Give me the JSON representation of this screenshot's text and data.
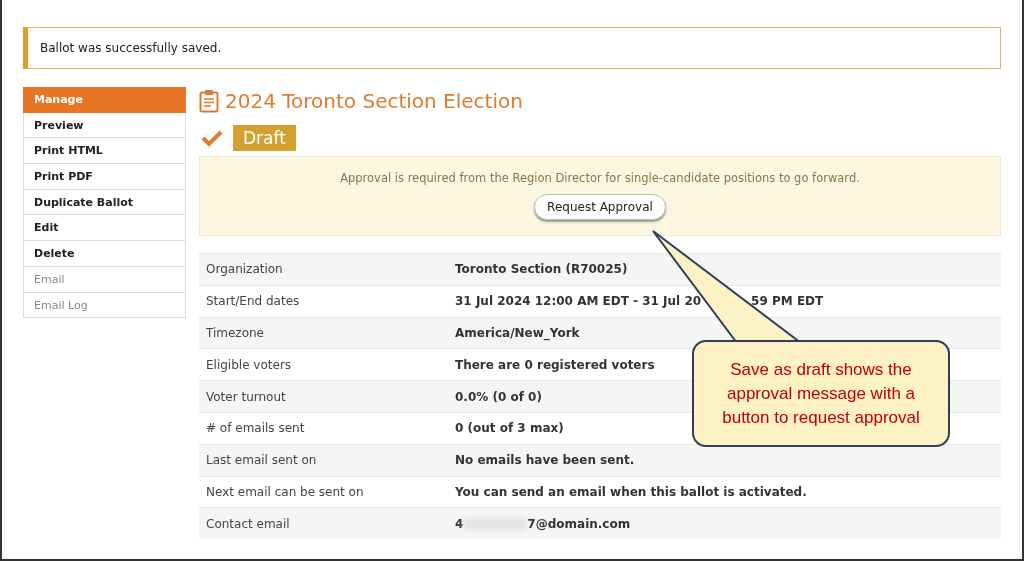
{
  "notice": {
    "text": "Ballot was successfully saved."
  },
  "sidebar": {
    "items": [
      {
        "label": "Manage",
        "selected": true,
        "disabled": false
      },
      {
        "label": "Preview",
        "selected": false,
        "disabled": false
      },
      {
        "label": "Print HTML",
        "selected": false,
        "disabled": false
      },
      {
        "label": "Print PDF",
        "selected": false,
        "disabled": false
      },
      {
        "label": "Duplicate Ballot",
        "selected": false,
        "disabled": false
      },
      {
        "label": "Edit",
        "selected": false,
        "disabled": false
      },
      {
        "label": "Delete",
        "selected": false,
        "disabled": false
      },
      {
        "label": "Email",
        "selected": false,
        "disabled": true
      },
      {
        "label": "Email Log",
        "selected": false,
        "disabled": true
      }
    ]
  },
  "title": "2024 Toronto Section Election",
  "status": {
    "label": "Draft"
  },
  "approval": {
    "message": "Approval is required from the Region Director for single-candidate positions to go forward.",
    "button": "Request Approval"
  },
  "details": {
    "rows": [
      {
        "kind": "plain",
        "label": "Organization",
        "value": "Toronto Section (R70025)"
      },
      {
        "kind": "covered",
        "label": "Start/End dates",
        "value": "31 Jul 2024 12:00 AM EDT - 31 Jul 20",
        "value_end": "59 PM EDT"
      },
      {
        "kind": "plain",
        "label": "Timezone",
        "value": "America/New_York"
      },
      {
        "kind": "plain",
        "label": "Eligible voters",
        "value": "There are 0 registered voters"
      },
      {
        "kind": "plain",
        "label": "Voter turnout",
        "value": "0.0% (0 of 0)"
      },
      {
        "kind": "plain",
        "label": "# of emails sent",
        "value": "0 (out of 3 max)"
      },
      {
        "kind": "plain",
        "label": "Last email sent on",
        "value": "No emails have been sent."
      },
      {
        "kind": "plain",
        "label": "Next email can be sent on",
        "value": "You can send an email when this ballot is activated."
      },
      {
        "kind": "redacted",
        "label": "Contact email",
        "value": "4",
        "value_end": "7@domain.com"
      }
    ]
  },
  "callout": {
    "text": "Save as draft shows the approval message with a button to request approval"
  }
}
